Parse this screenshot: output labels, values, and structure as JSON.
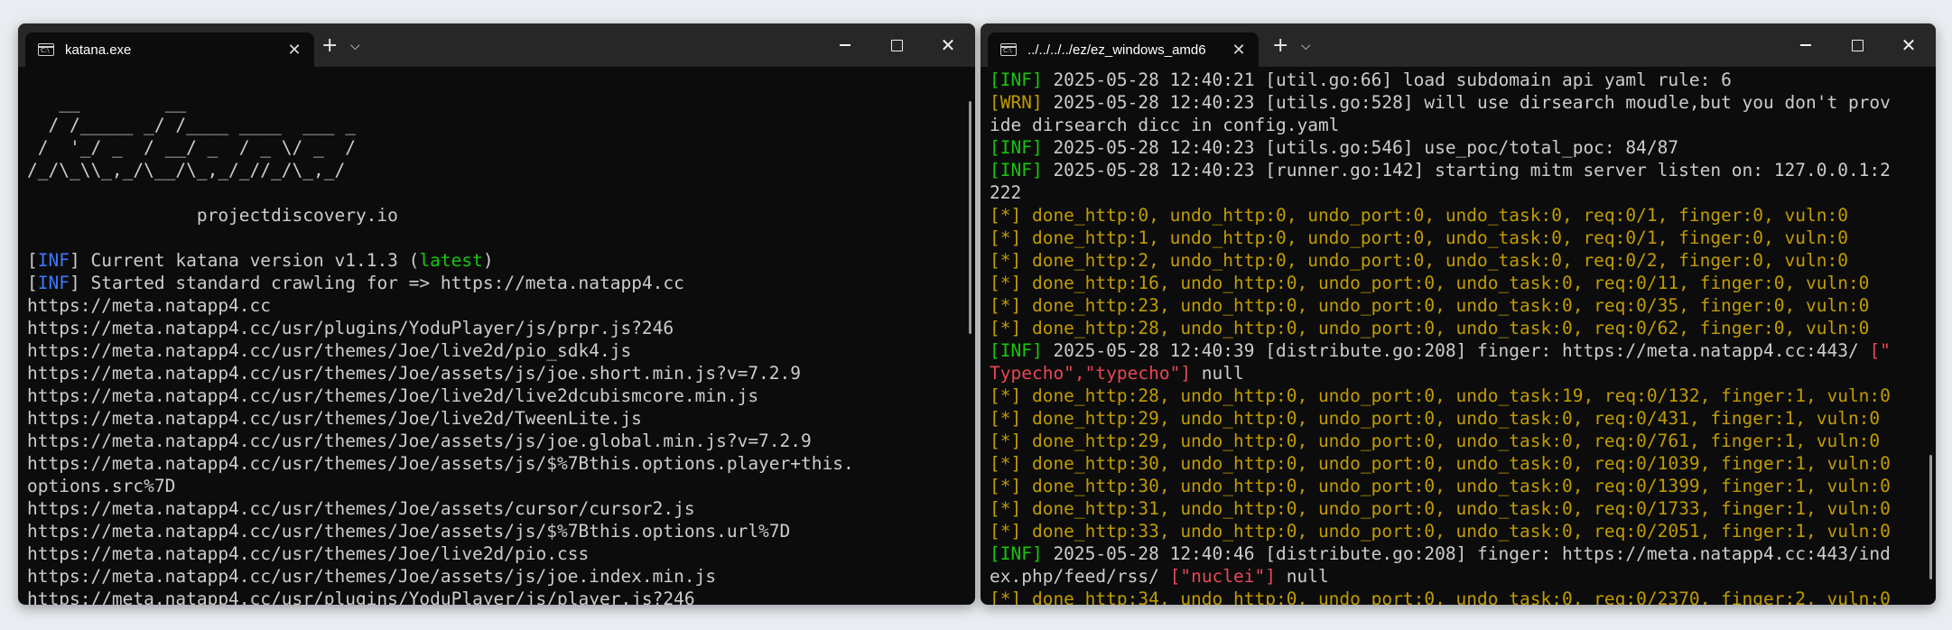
{
  "left": {
    "tab_title": "katana.exe",
    "tab_icon_text": "C:\\",
    "lines": [
      [
        {
          "t": ""
        }
      ],
      [
        {
          "t": "   __        __"
        }
      ],
      [
        {
          "t": "  / /_____ _/ /____ ____  ___ _"
        }
      ],
      [
        {
          "t": " /  '_/ _  / __/ _  / _ \\/ _  /"
        }
      ],
      [
        {
          "t": "/_/\\_\\\\_,_/\\__/\\_,_/_//_/\\_,_/"
        }
      ],
      [
        {
          "t": ""
        }
      ],
      [
        {
          "t": "\t\tprojectdiscovery.io"
        }
      ],
      [
        {
          "t": ""
        }
      ],
      [
        {
          "t": "["
        },
        {
          "t": "INF",
          "c": "blue"
        },
        {
          "t": "] Current katana version v1.1.3 ("
        },
        {
          "t": "latest",
          "c": "green"
        },
        {
          "t": ")"
        }
      ],
      [
        {
          "t": "["
        },
        {
          "t": "INF",
          "c": "blue"
        },
        {
          "t": "] Started standard crawling for => https://meta.natapp4.cc"
        }
      ],
      [
        {
          "t": "https://meta.natapp4.cc"
        }
      ],
      [
        {
          "t": "https://meta.natapp4.cc/usr/plugins/YoduPlayer/js/prpr.js?246"
        }
      ],
      [
        {
          "t": "https://meta.natapp4.cc/usr/themes/Joe/live2d/pio_sdk4.js"
        }
      ],
      [
        {
          "t": "https://meta.natapp4.cc/usr/themes/Joe/assets/js/joe.short.min.js?v=7.2.9"
        }
      ],
      [
        {
          "t": "https://meta.natapp4.cc/usr/themes/Joe/live2d/live2dcubismcore.min.js"
        }
      ],
      [
        {
          "t": "https://meta.natapp4.cc/usr/themes/Joe/live2d/TweenLite.js"
        }
      ],
      [
        {
          "t": "https://meta.natapp4.cc/usr/themes/Joe/assets/js/joe.global.min.js?v=7.2.9"
        }
      ],
      [
        {
          "t": "https://meta.natapp4.cc/usr/themes/Joe/assets/js/$%7Bthis.options.player+this."
        }
      ],
      [
        {
          "t": "options.src%7D"
        }
      ],
      [
        {
          "t": "https://meta.natapp4.cc/usr/themes/Joe/assets/cursor/cursor2.js"
        }
      ],
      [
        {
          "t": "https://meta.natapp4.cc/usr/themes/Joe/assets/js/$%7Bthis.options.url%7D"
        }
      ],
      [
        {
          "t": "https://meta.natapp4.cc/usr/themes/Joe/live2d/pio.css"
        }
      ],
      [
        {
          "t": "https://meta.natapp4.cc/usr/themes/Joe/assets/js/joe.index.min.js"
        }
      ],
      [
        {
          "t": "https://meta.natapp4.cc/usr/plugins/YoduPlayer/js/player.js?246"
        }
      ]
    ]
  },
  "right": {
    "tab_title": "../../../../ez/ez_windows_amd6",
    "tab_icon_text": "C:\\",
    "lines": [
      [
        {
          "t": "[INF]",
          "c": "green"
        },
        {
          "t": " 2025-05-28 12:40:21 [util.go:66] load subdomain api yaml rule: 6"
        }
      ],
      [
        {
          "t": "[WRN]",
          "c": "yellow"
        },
        {
          "t": " 2025-05-28 12:40:23 [utils.go:528] will use dirsearch moudle,but you don't prov"
        }
      ],
      [
        {
          "t": "ide dirsearch dicc in config.yaml"
        }
      ],
      [
        {
          "t": "[INF]",
          "c": "green"
        },
        {
          "t": " 2025-05-28 12:40:23 [utils.go:546] use_poc/total_poc: 84/87"
        }
      ],
      [
        {
          "t": "[INF]",
          "c": "green"
        },
        {
          "t": " 2025-05-28 12:40:23 [runner.go:142] starting mitm server listen on: 127.0.0.1:2"
        }
      ],
      [
        {
          "t": "222"
        }
      ],
      [
        {
          "t": "[*] done_http:0, undo_http:0, undo_port:0, undo_task:0, req:0/1, finger:0, vuln:0",
          "c": "yellow"
        }
      ],
      [
        {
          "t": "[*] done_http:1, undo_http:0, undo_port:0, undo_task:0, req:0/1, finger:0, vuln:0",
          "c": "yellow"
        }
      ],
      [
        {
          "t": "[*] done_http:2, undo_http:0, undo_port:0, undo_task:0, req:0/2, finger:0, vuln:0",
          "c": "yellow"
        }
      ],
      [
        {
          "t": "[*] done_http:16, undo_http:0, undo_port:0, undo_task:0, req:0/11, finger:0, vuln:0",
          "c": "yellow"
        }
      ],
      [
        {
          "t": "[*] done_http:23, undo_http:0, undo_port:0, undo_task:0, req:0/35, finger:0, vuln:0",
          "c": "yellow"
        }
      ],
      [
        {
          "t": "[*] done_http:28, undo_http:0, undo_port:0, undo_task:0, req:0/62, finger:0, vuln:0",
          "c": "yellow"
        }
      ],
      [
        {
          "t": "[INF]",
          "c": "green"
        },
        {
          "t": " 2025-05-28 12:40:39 [distribute.go:208] finger: https://meta.natapp4.cc:443/ "
        },
        {
          "t": "[\"",
          "c": "red"
        }
      ],
      [
        {
          "t": "Typecho\",\"typecho\"]",
          "c": "red"
        },
        {
          "t": " null"
        }
      ],
      [
        {
          "t": "[*] done_http:28, undo_http:0, undo_port:0, undo_task:19, req:0/132, finger:1, vuln:0",
          "c": "yellow"
        }
      ],
      [
        {
          "t": "[*] done_http:29, undo_http:0, undo_port:0, undo_task:0, req:0/431, finger:1, vuln:0",
          "c": "yellow"
        }
      ],
      [
        {
          "t": "[*] done_http:29, undo_http:0, undo_port:0, undo_task:0, req:0/761, finger:1, vuln:0",
          "c": "yellow"
        }
      ],
      [
        {
          "t": "[*] done_http:30, undo_http:0, undo_port:0, undo_task:0, req:0/1039, finger:1, vuln:0",
          "c": "yellow"
        }
      ],
      [
        {
          "t": "[*] done_http:30, undo_http:0, undo_port:0, undo_task:0, req:0/1399, finger:1, vuln:0",
          "c": "yellow"
        }
      ],
      [
        {
          "t": "[*] done_http:31, undo_http:0, undo_port:0, undo_task:0, req:0/1733, finger:1, vuln:0",
          "c": "yellow"
        }
      ],
      [
        {
          "t": "[*] done_http:33, undo_http:0, undo_port:0, undo_task:0, req:0/2051, finger:1, vuln:0",
          "c": "yellow"
        }
      ],
      [
        {
          "t": "[INF]",
          "c": "green"
        },
        {
          "t": " 2025-05-28 12:40:46 [distribute.go:208] finger: https://meta.natapp4.cc:443/ind"
        }
      ],
      [
        {
          "t": "ex.php/feed/rss/ "
        },
        {
          "t": "[\"nuclei\"]",
          "c": "red"
        },
        {
          "t": " null"
        }
      ],
      [
        {
          "t": "[*] done_http:34, undo_http:0, undo_port:0, undo_task:0, req:0/2370, finger:2, vuln:0",
          "c": "yellow"
        }
      ]
    ]
  },
  "colors": {
    "blue": "#3b78ff",
    "green": "#16c60c",
    "yellow": "#c19c00",
    "red": "#e74856",
    "text": "#cccccc",
    "background": "#0c0c0c",
    "titlebar": "#272727"
  }
}
